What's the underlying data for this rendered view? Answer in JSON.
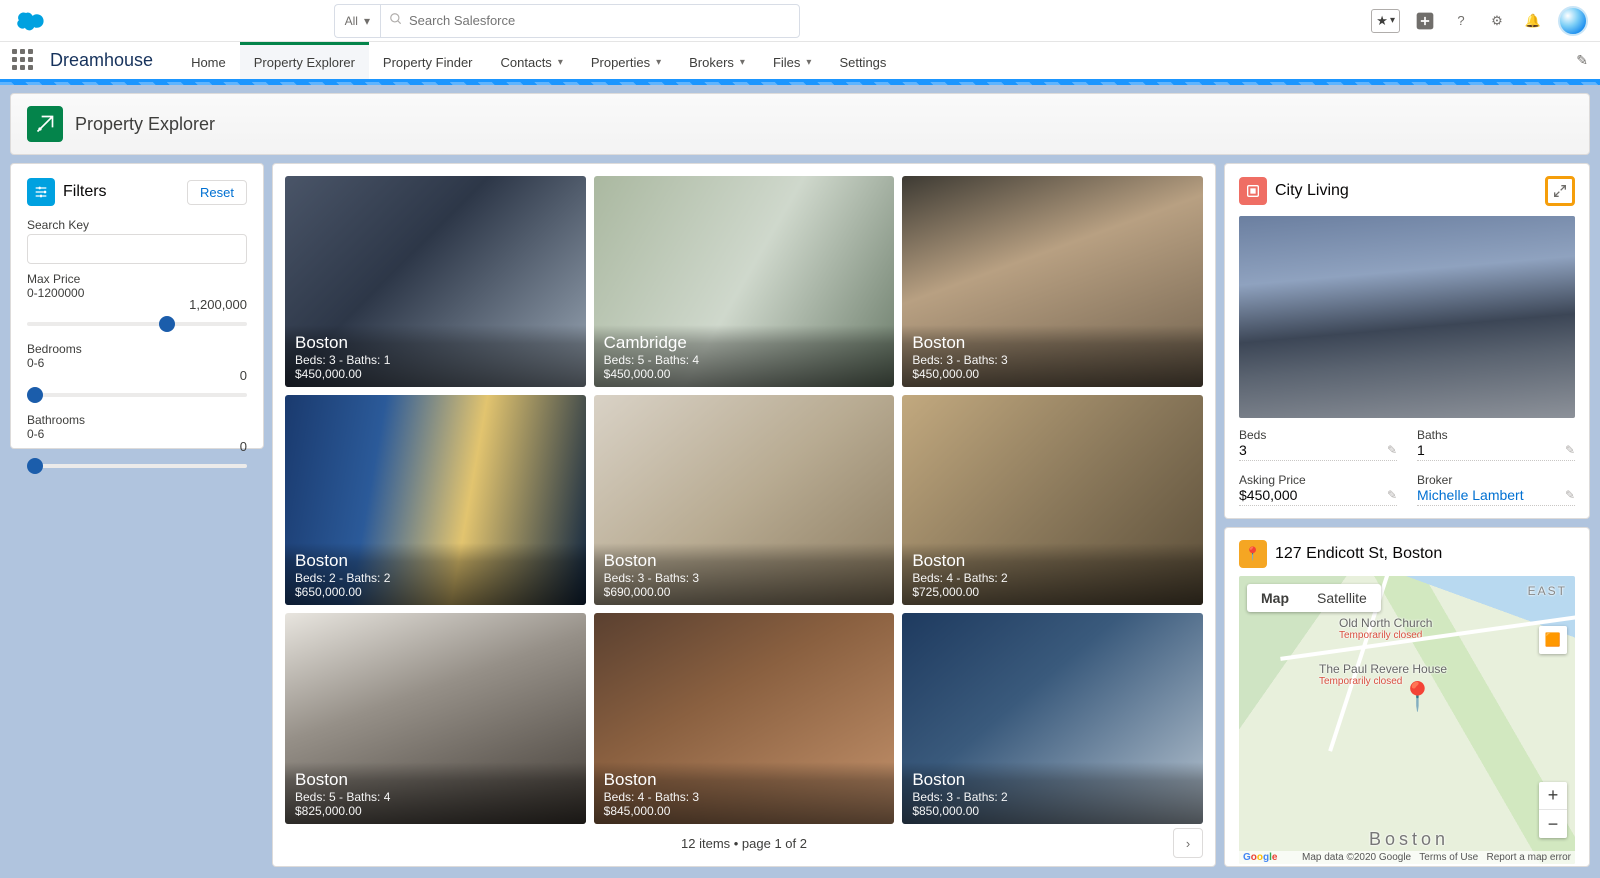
{
  "header": {
    "search_scope": "All",
    "search_placeholder": "Search Salesforce"
  },
  "nav": {
    "app_name": "Dreamhouse",
    "items": [
      {
        "label": "Home",
        "dropdown": false,
        "active": false
      },
      {
        "label": "Property Explorer",
        "dropdown": false,
        "active": true
      },
      {
        "label": "Property Finder",
        "dropdown": false,
        "active": false
      },
      {
        "label": "Contacts",
        "dropdown": true,
        "active": false
      },
      {
        "label": "Properties",
        "dropdown": true,
        "active": false
      },
      {
        "label": "Brokers",
        "dropdown": true,
        "active": false
      },
      {
        "label": "Files",
        "dropdown": true,
        "active": false
      },
      {
        "label": "Settings",
        "dropdown": false,
        "active": false
      }
    ]
  },
  "page": {
    "title": "Property Explorer"
  },
  "filters": {
    "title": "Filters",
    "reset": "Reset",
    "search_key_label": "Search Key",
    "max_price_label": "Max Price",
    "max_price_range": "0-1200000",
    "max_price_value": "1,200,000",
    "bedrooms_label": "Bedrooms",
    "bedrooms_range": "0-6",
    "bedrooms_value": "0",
    "bathrooms_label": "Bathrooms",
    "bathrooms_range": "0-6",
    "bathrooms_value": "0"
  },
  "grid": {
    "items": [
      {
        "city": "Boston",
        "meta": "Beds: 3 - Baths: 1",
        "price": "$450,000.00",
        "bg": "linear-gradient(135deg,#4a5568,#2d3748 40%,#9aa7b5)"
      },
      {
        "city": "Cambridge",
        "meta": "Beds: 5 - Baths: 4",
        "price": "$450,000.00",
        "bg": "linear-gradient(120deg,#aab8a0,#cfd8cc 50%,#6b7c6a)"
      },
      {
        "city": "Boston",
        "meta": "Beds: 3 - Baths: 3",
        "price": "$450,000.00",
        "bg": "linear-gradient(160deg,#3d3a33,#b8a082 40%,#6e5f4c)"
      },
      {
        "city": "Boston",
        "meta": "Beds: 2 - Baths: 2",
        "price": "$650,000.00",
        "bg": "linear-gradient(100deg,#1a3a6e,#2b5a99 30%,#e2c46f 60%,#0f2540)"
      },
      {
        "city": "Boston",
        "meta": "Beds: 3 - Baths: 3",
        "price": "$690,000.00",
        "bg": "linear-gradient(140deg,#d9d2c6,#b8ab92 50%,#8a7a5f)"
      },
      {
        "city": "Boston",
        "meta": "Beds: 4 - Baths: 2",
        "price": "$725,000.00",
        "bg": "linear-gradient(135deg,#c2a97f,#8c7a5c 50%,#5a4d38)"
      },
      {
        "city": "Boston",
        "meta": "Beds: 5 - Baths: 4",
        "price": "$825,000.00",
        "bg": "linear-gradient(160deg,#e8e5df,#969088 40%,#403a34)"
      },
      {
        "city": "Boston",
        "meta": "Beds: 4 - Baths: 3",
        "price": "$845,000.00",
        "bg": "linear-gradient(150deg,#5a4030,#8a6040 40%,#c5936c)"
      },
      {
        "city": "Boston",
        "meta": "Beds: 3 - Baths: 2",
        "price": "$850,000.00",
        "bg": "linear-gradient(140deg,#1e3a5f,#3a5a7c 40%,#b8c5d1)"
      }
    ],
    "pager": "12 items • page 1 of 2"
  },
  "detail": {
    "title": "City Living",
    "hero_bg": "linear-gradient(175deg,#6b7fa0 0%,#8fa2bf 30%,#3c4656 55%,#5a6370 70%,#8c9199 100%)",
    "fields": {
      "beds_label": "Beds",
      "beds": "3",
      "baths_label": "Baths",
      "baths": "1",
      "price_label": "Asking Price",
      "price": "$450,000",
      "broker_label": "Broker",
      "broker": "Michelle Lambert"
    }
  },
  "map": {
    "title": "127 Endicott St, Boston",
    "map_tab": "Map",
    "sat_tab": "Satellite",
    "attrib_data": "Map data ©2020 Google",
    "attrib_tos": "Terms of Use",
    "attrib_report": "Report a map error",
    "label1": "Old North Church",
    "label1b": "Temporarily closed",
    "label2": "The Paul Revere House",
    "label2b": "Temporarily closed",
    "label3": "Boston",
    "label4": "EAST"
  }
}
